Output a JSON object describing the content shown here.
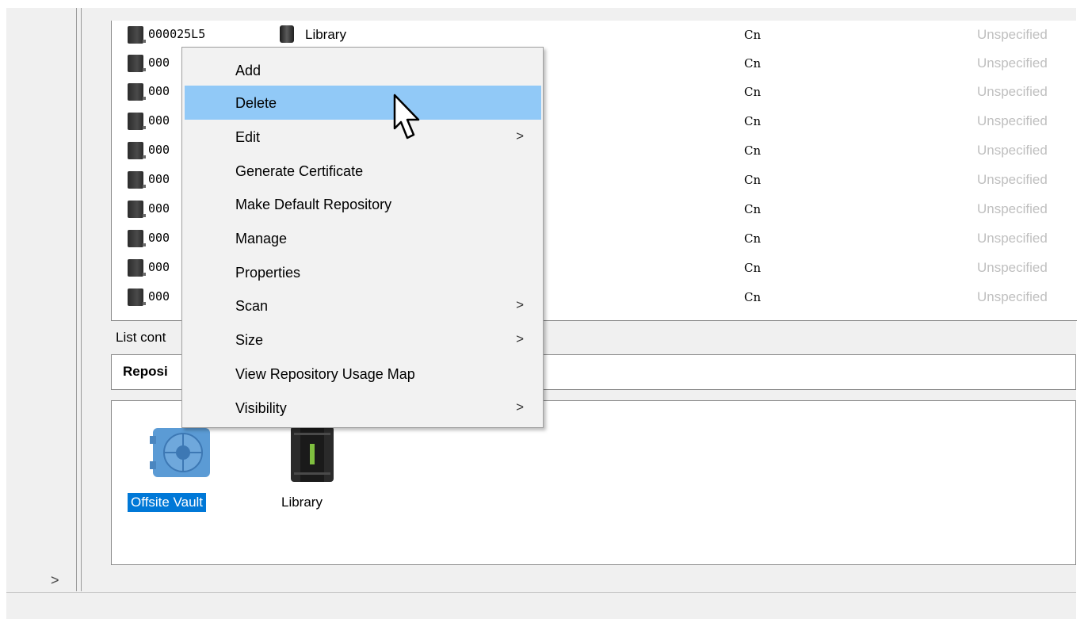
{
  "media_list": {
    "rows": [
      {
        "barcode": "000025L5",
        "type": "Library",
        "media": "Cn",
        "location": "Unspecified"
      },
      {
        "barcode": "000",
        "type": "",
        "media": "Cn",
        "location": "Unspecified"
      },
      {
        "barcode": "000",
        "type": "",
        "media": "Cn",
        "location": "Unspecified"
      },
      {
        "barcode": "000",
        "type": "",
        "media": "Cn",
        "location": "Unspecified"
      },
      {
        "barcode": "000",
        "type": "",
        "media": "Cn",
        "location": "Unspecified"
      },
      {
        "barcode": "000",
        "type": "",
        "media": "Cn",
        "location": "Unspecified"
      },
      {
        "barcode": "000",
        "type": "",
        "media": "Cn",
        "location": "Unspecified"
      },
      {
        "barcode": "000",
        "type": "",
        "media": "Cn",
        "location": "Unspecified"
      },
      {
        "barcode": "000",
        "type": "",
        "media": "Cn",
        "location": "Unspecified"
      },
      {
        "barcode": "000",
        "type": "",
        "media": "Cn",
        "location": "Unspecified"
      }
    ],
    "status": "List cont"
  },
  "repositories": {
    "header": "Reposi",
    "items": [
      {
        "label": "Offsite Vault",
        "icon": "vault-icon",
        "selected": true
      },
      {
        "label": "Library",
        "icon": "library-icon",
        "selected": false
      }
    ]
  },
  "context_menu": {
    "items": [
      {
        "label": "Add",
        "submenu": false
      },
      {
        "label": "Delete",
        "submenu": false,
        "highlighted": true
      },
      {
        "label": "Edit",
        "submenu": true
      },
      {
        "label": "Generate Certificate",
        "submenu": false
      },
      {
        "label": "Make Default Repository",
        "submenu": false
      },
      {
        "label": "Manage",
        "submenu": false
      },
      {
        "label": "Properties",
        "submenu": false
      },
      {
        "label": "Scan",
        "submenu": true
      },
      {
        "label": "Size",
        "submenu": true
      },
      {
        "label": "View Repository Usage Map",
        "submenu": false
      },
      {
        "label": "Visibility",
        "submenu": true
      }
    ],
    "submenu_glyph": ">"
  },
  "nav": {
    "expand_glyph": ">"
  },
  "colors": {
    "highlight": "#91c9f7",
    "selection": "#0078d7",
    "muted_text": "#bfbfbf"
  }
}
